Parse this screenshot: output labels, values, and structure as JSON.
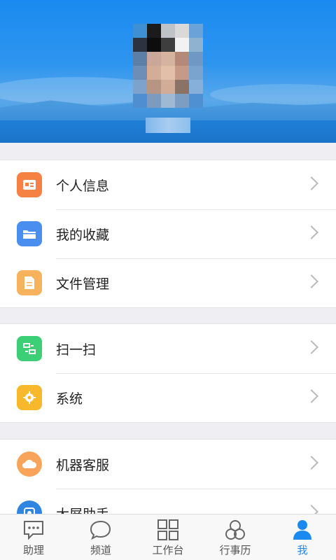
{
  "profile": {
    "avatar_icon": "avatar-pixelated",
    "avatar_pixels": [
      [
        "#3f8fd4",
        "#1b1b1b",
        "#bfc3c7",
        "#d9d9d9",
        "#6aa3d8"
      ],
      [
        "#2c3240",
        "#0d0d0d",
        "#3e3e3e",
        "#f2f2f2",
        "#8fb2d0"
      ],
      [
        "#5b7fa6",
        "#cba79a",
        "#d6b2a1",
        "#b48977",
        "#6f98c4"
      ],
      [
        "#6d8fb7",
        "#d4ad98",
        "#e2bfa8",
        "#c79a86",
        "#7aa3cd"
      ],
      [
        "#7da2cc",
        "#b69584",
        "#d1ad97",
        "#8a7266",
        "#86b0da"
      ],
      [
        "#4f8ed0",
        "#7d9bbe",
        "#9fb9d4",
        "#7d9ec3",
        "#4e90d2"
      ]
    ]
  },
  "sections": [
    {
      "items": [
        {
          "label": "个人信息",
          "icon": "id-card-icon",
          "color": "#f58243"
        },
        {
          "label": "我的收藏",
          "icon": "folder-icon",
          "color": "#4a8ff0"
        },
        {
          "label": "文件管理",
          "icon": "document-icon",
          "color": "#f7b25e"
        }
      ]
    },
    {
      "items": [
        {
          "label": "扫一扫",
          "icon": "scan-icon",
          "color": "#3ccf76"
        },
        {
          "label": "系统",
          "icon": "gear-icon",
          "color": "#f7b92b"
        }
      ]
    },
    {
      "items": [
        {
          "label": "机器客服",
          "icon": "cloud-icon",
          "color": "#f8a45a"
        },
        {
          "label": "大屏助手",
          "icon": "screen-assistant-icon",
          "color": "#2f86e0"
        }
      ]
    }
  ],
  "tabbar": {
    "tabs": [
      {
        "label": "助理",
        "icon": "chat-bubble-icon",
        "active": false
      },
      {
        "label": "频道",
        "icon": "speech-bubble-icon",
        "active": false
      },
      {
        "label": "工作台",
        "icon": "grid-icon",
        "active": false
      },
      {
        "label": "行事历",
        "icon": "calendar-icon",
        "active": false
      },
      {
        "label": "我",
        "icon": "person-icon",
        "active": true
      }
    ],
    "active_color": "#1a8af0"
  }
}
